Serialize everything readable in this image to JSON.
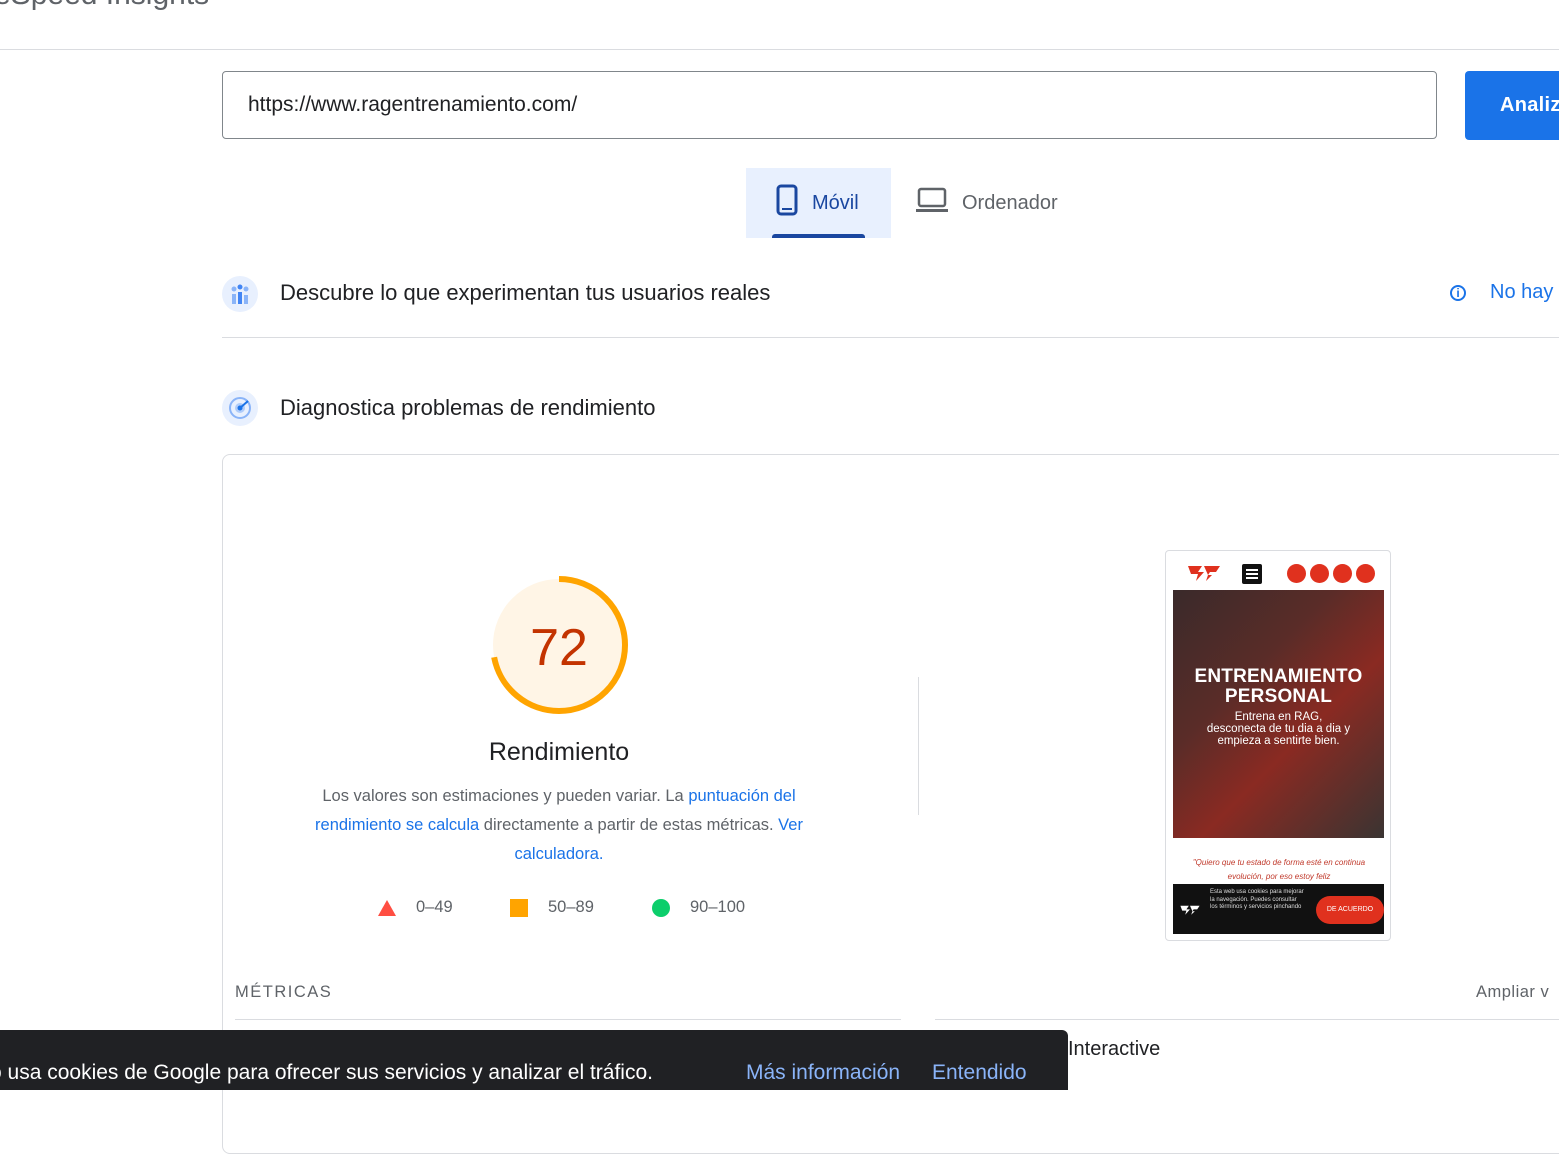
{
  "header": {
    "app_title": "eSpeed Insights"
  },
  "search": {
    "url_value": "https://www.ragentrenamiento.com/",
    "analyze_label": "Analiz"
  },
  "tabs": [
    {
      "label": "Móvil",
      "icon": "smartphone-icon",
      "selected": true
    },
    {
      "label": "Ordenador",
      "icon": "laptop-icon",
      "selected": false
    }
  ],
  "field_section": {
    "title": "Descubre lo que experimentan tus usuarios reales",
    "icon": "users-chart-icon",
    "no_data_label": "No hay"
  },
  "lab_section": {
    "title": "Diagnostica problemas de rendimiento",
    "icon": "radar-icon"
  },
  "performance": {
    "score": "72",
    "score_value": 72,
    "score_color": "#c33300",
    "arc_color": "#ffa400",
    "label": "Rendimiento",
    "disclaimer_prefix": "Los valores son estimaciones y pueden variar. La ",
    "disclaimer_link1": "puntuación del rendimiento se calcula",
    "disclaimer_middle": " directamente a partir de estas métricas. ",
    "disclaimer_link2": "Ver calculadora.",
    "legend": [
      {
        "range": "0–49",
        "shape": "triangle",
        "color": "#ff4e42"
      },
      {
        "range": "50–89",
        "shape": "square",
        "color": "#ffa400"
      },
      {
        "range": "90–100",
        "shape": "circle",
        "color": "#0cce6b"
      }
    ]
  },
  "thumbnail": {
    "hero_title": "ENTRENAMIENTO PERSONAL",
    "hero_subtitle": "Entrena en RAG, desconecta de tu dia a dia y empieza a sentirte bien.",
    "quote": "\"Quiero que tu estado de forma esté en continua evolución, por eso  estoy feliz",
    "cookie_text": "Esta web usa cookies para mejorar la navegación. Puedes consultar los términos y servicios pinchando",
    "cookie_button": "DE ACUERDO"
  },
  "metrics": {
    "title": "MÉTRICAS",
    "expand_label": "Ampliar v",
    "visible_metric": "Interactive"
  },
  "cookie_banner": {
    "text": "o usa cookies de Google para ofrecer sus servicios y analizar el tráfico.",
    "more_info": "Más información",
    "accept": "Entendido"
  }
}
